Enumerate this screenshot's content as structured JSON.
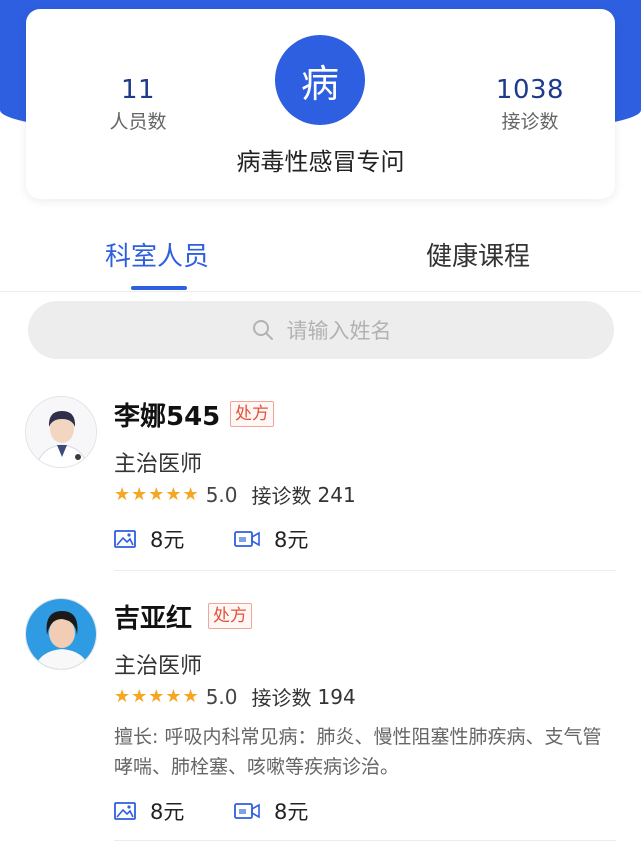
{
  "header": {
    "logo_char": "病",
    "left_stat": {
      "value": "11",
      "label": "人员数"
    },
    "right_stat": {
      "value": "1038",
      "label": "接诊数"
    },
    "dept_name": "病毒性感冒专问"
  },
  "tabs": [
    {
      "label": "科室人员",
      "active": true
    },
    {
      "label": "健康课程",
      "active": false
    }
  ],
  "search": {
    "placeholder": "请输入姓名"
  },
  "doctors": [
    {
      "name": "李娜545",
      "badge": "处方",
      "title": "主治医师",
      "stars": "★★★★★",
      "score": "5.0",
      "consult_label": "接诊数",
      "consult_count": "241",
      "image_price": "8元",
      "video_price": "8元"
    },
    {
      "name": "吉亚红",
      "badge": "处方",
      "title": "主治医师",
      "stars": "★★★★★",
      "score": "5.0",
      "consult_label": "接诊数",
      "consult_count": "194",
      "specialty": "擅长: 呼吸内科常见病：肺炎、慢性阻塞性肺疾病、支气管哮喘、肺栓塞、咳嗽等疾病诊治。",
      "image_price": "8元",
      "video_price": "8元"
    }
  ],
  "colors": {
    "brand": "#2d5fe0",
    "star": "#f5a623",
    "badge": "#e2533b"
  }
}
